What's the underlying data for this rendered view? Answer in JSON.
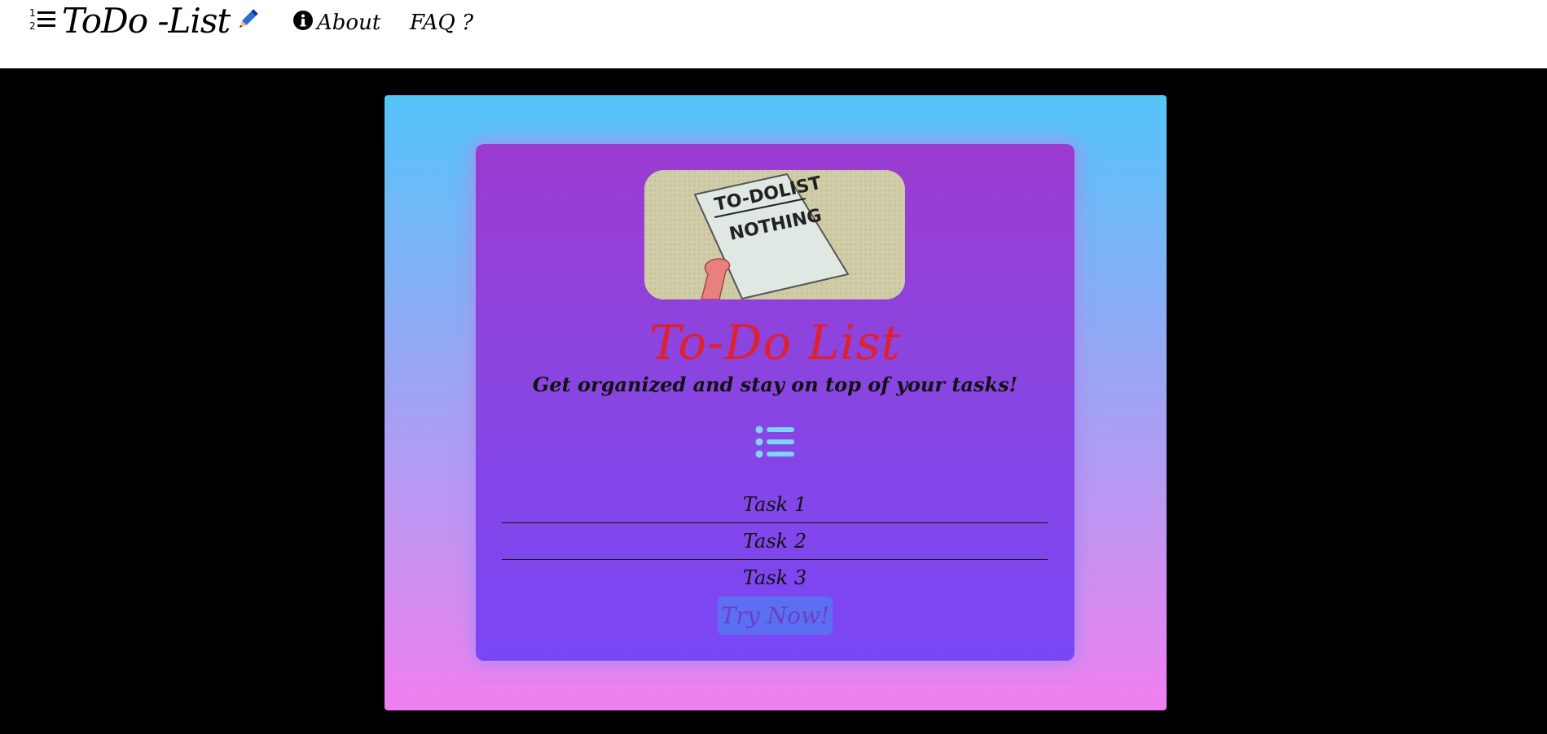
{
  "navbar": {
    "brand_text": "ToDo -List",
    "about_label": "About",
    "faq_label": "FAQ ?"
  },
  "hero_image": {
    "paper_heading": "TO-DOLIST",
    "paper_item": "NOTHING"
  },
  "main": {
    "title": "To-Do List",
    "subtitle": "Get organized and stay on top of your tasks!",
    "tasks": [
      "Task 1",
      "Task 2",
      "Task 3"
    ],
    "cta_label": "Try Now!"
  },
  "icons": {
    "brand_list": "numbered-list-icon",
    "brand_pen": "pen-icon",
    "about": "info-circle-icon",
    "center": "list-icon"
  },
  "colors": {
    "title": "#e0202a",
    "outer_gradient_top": "#54c5f8",
    "outer_gradient_bottom": "#f07fef",
    "inner_gradient_top": "#9b3bd0",
    "inner_gradient_bottom": "#7a46f5",
    "list_icon": "#7fd4ff",
    "button_bg": "#5b6ff0"
  }
}
